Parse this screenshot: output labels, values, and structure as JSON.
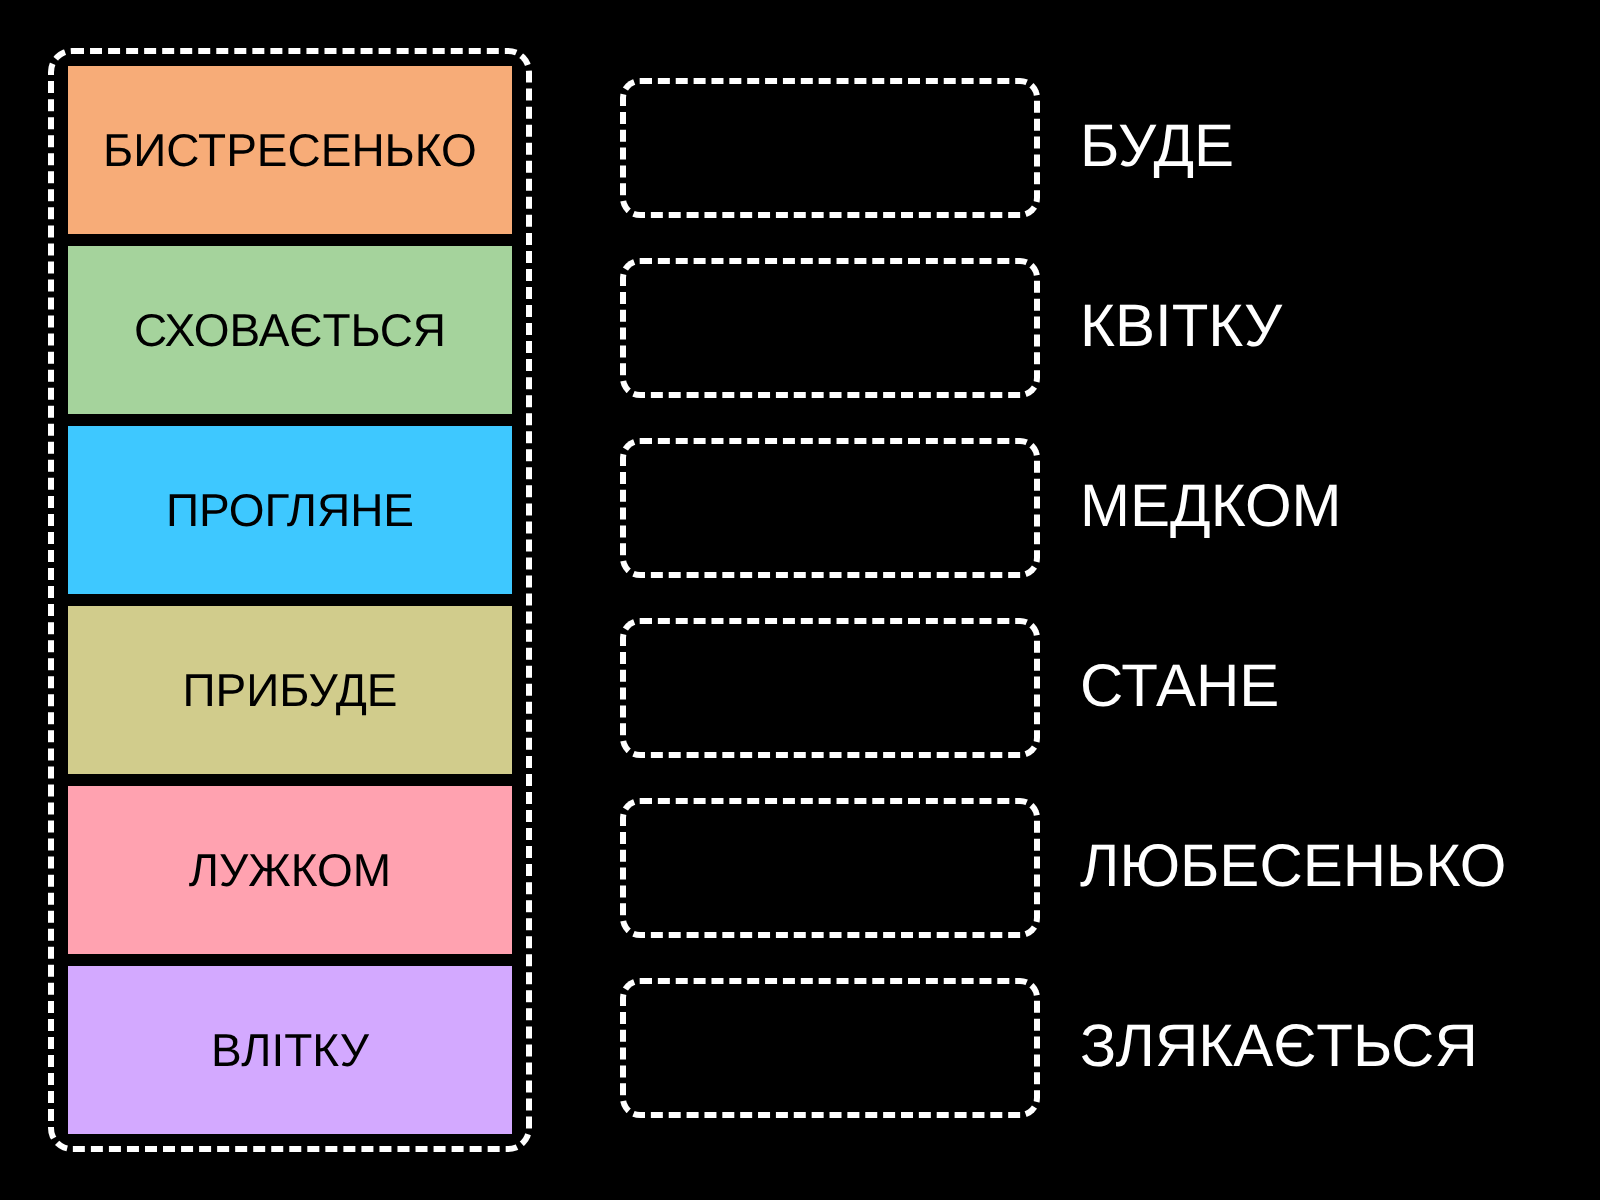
{
  "word_tiles": [
    {
      "text": "БИСТРЕСЕНЬКО",
      "color": "#f7ac78"
    },
    {
      "text": "СХОВАЄТЬСЯ",
      "color": "#a5d39c"
    },
    {
      "text": "ПРОГЛЯНЕ",
      "color": "#3ec8ff"
    },
    {
      "text": "ПРИБУДЕ",
      "color": "#d1cc8c"
    },
    {
      "text": "ЛУЖКОМ",
      "color": "#ffa2b0"
    },
    {
      "text": "ВЛІТКУ",
      "color": "#d3a9ff"
    }
  ],
  "answer_rows": [
    {
      "word": "БУДЕ"
    },
    {
      "word": "КВІТКУ"
    },
    {
      "word": "МЕДКОМ"
    },
    {
      "word": "СТАНЕ"
    },
    {
      "word": "ЛЮБЕСЕНЬКО"
    },
    {
      "word": "ЗЛЯКАЄТЬСЯ"
    }
  ]
}
